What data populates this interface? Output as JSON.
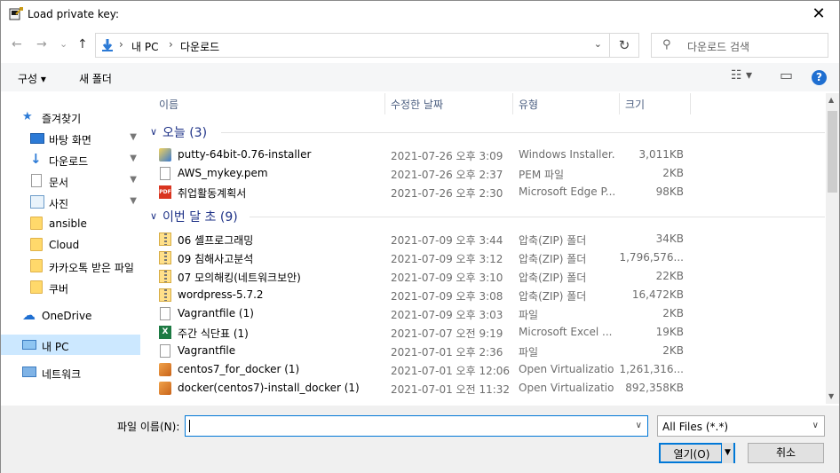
{
  "window": {
    "title": "Load private key:",
    "close_glyph": "✕"
  },
  "nav": {
    "back": "←",
    "forward": "→",
    "recent": "⌄",
    "up": "↑"
  },
  "address": {
    "crumbs": [
      "내 PC",
      "다운로드"
    ],
    "separator": "›",
    "dropdown": "⌄",
    "refresh": "↻"
  },
  "search": {
    "placeholder": "다운로드 검색",
    "icon": "⚲"
  },
  "toolbar": {
    "organize": "구성 ▾",
    "new_folder": "새 폴더",
    "view_glyph": "☷ ▾",
    "pane_glyph": "▭",
    "help": "?"
  },
  "sidebar": {
    "items": [
      {
        "label": "즐겨찾기",
        "icon": "star-icon",
        "pin": false
      },
      {
        "label": "바탕 화면",
        "icon": "desktop-icon",
        "pin": true
      },
      {
        "label": "다운로드",
        "icon": "download-icon",
        "pin": true
      },
      {
        "label": "문서",
        "icon": "document-icon",
        "pin": true
      },
      {
        "label": "사진",
        "icon": "pictures-icon",
        "pin": true
      },
      {
        "label": "ansible",
        "icon": "folder-icon",
        "pin": false
      },
      {
        "label": "Cloud",
        "icon": "folder-icon",
        "pin": false
      },
      {
        "label": "카카오톡 받은 파일",
        "icon": "folder-icon",
        "pin": false
      },
      {
        "label": "쿠버",
        "icon": "folder-icon",
        "pin": false
      },
      {
        "label": "OneDrive",
        "icon": "cloud-icon",
        "pin": false
      },
      {
        "label": "내 PC",
        "icon": "pc-icon",
        "pin": false,
        "selected": true
      },
      {
        "label": "네트워크",
        "icon": "network-icon",
        "pin": false
      }
    ],
    "pin_glyph": "📌"
  },
  "columns": {
    "name": "이름",
    "date": "수정한 날짜",
    "type": "유형",
    "size": "크기",
    "sort": "^"
  },
  "groups": [
    {
      "label": "오늘 (3)",
      "files": [
        {
          "name": "putty-64bit-0.76-installer",
          "date": "2021-07-26 오후 3:09",
          "type": "Windows Installer...",
          "size": "3,011KB",
          "icon": "msi"
        },
        {
          "name": "AWS_mykey.pem",
          "date": "2021-07-26 오후 2:37",
          "type": "PEM 파일",
          "size": "2KB",
          "icon": "doc"
        },
        {
          "name": "취업활동계획서",
          "date": "2021-07-26 오후 2:30",
          "type": "Microsoft Edge P...",
          "size": "98KB",
          "icon": "pdf"
        }
      ]
    },
    {
      "label": "이번 달 초 (9)",
      "files": [
        {
          "name": "06 셸프로그래밍",
          "date": "2021-07-09 오후 3:44",
          "type": "압축(ZIP) 폴더",
          "size": "34KB",
          "icon": "zip"
        },
        {
          "name": "09 침해사고분석",
          "date": "2021-07-09 오후 3:12",
          "type": "압축(ZIP) 폴더",
          "size": "1,796,576...",
          "icon": "zip"
        },
        {
          "name": "07 모의해킹(네트워크보안)",
          "date": "2021-07-09 오후 3:10",
          "type": "압축(ZIP) 폴더",
          "size": "22KB",
          "icon": "zip"
        },
        {
          "name": "wordpress-5.7.2",
          "date": "2021-07-09 오후 3:08",
          "type": "압축(ZIP) 폴더",
          "size": "16,472KB",
          "icon": "zip"
        },
        {
          "name": "Vagrantfile (1)",
          "date": "2021-07-09 오후 3:03",
          "type": "파일",
          "size": "2KB",
          "icon": "doc"
        },
        {
          "name": "주간 식단표 (1)",
          "date": "2021-07-07 오전 9:19",
          "type": "Microsoft Excel ...",
          "size": "19KB",
          "icon": "xls"
        },
        {
          "name": "Vagrantfile",
          "date": "2021-07-01 오후 2:36",
          "type": "파일",
          "size": "2KB",
          "icon": "doc"
        },
        {
          "name": "centos7_for_docker (1)",
          "date": "2021-07-01 오후 12:06",
          "type": "Open Virtualizatio...",
          "size": "1,261,316...",
          "icon": "box"
        },
        {
          "name": "docker(centos7)-install_docker (1)",
          "date": "2021-07-01 오전 11:32",
          "type": "Open Virtualizatio...",
          "size": "892,358KB",
          "icon": "box"
        }
      ]
    }
  ],
  "footer": {
    "filename_label": "파일 이름(N):",
    "filename_value": "",
    "filter_value": "All Files (*.*)",
    "open_label": "열기(O)",
    "cancel_label": "취소"
  },
  "colors": {
    "accent": "#0078d7",
    "selected_bg": "#cce8ff",
    "group_text": "#1e3287"
  }
}
